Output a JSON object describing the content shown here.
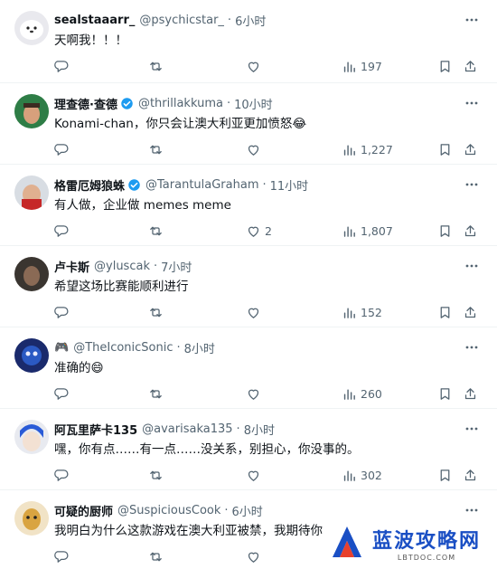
{
  "tweets": [
    {
      "name": "sealstaaarr_",
      "handle": "@psychicstar_",
      "time": "6小时",
      "text": "天啊我！！！",
      "verified": false,
      "likes": "",
      "views": "197"
    },
    {
      "name": "理查德·查德",
      "handle": "@thrillakkuma",
      "time": "10小时",
      "text": "Konami-chan，你只会让澳大利亚更加愤怒😂",
      "verified": true,
      "likes": "",
      "views": "1,227"
    },
    {
      "name": "格雷厄姆狼蛛",
      "handle": "@TarantulaGraham",
      "time": "11小时",
      "text": "有人做，企业做 memes meme",
      "verified": true,
      "likes": "2",
      "views": "1,807"
    },
    {
      "name": "卢卡斯",
      "handle": "@yluscak",
      "time": "7小时",
      "text": "希望这场比赛能顺利进行",
      "verified": false,
      "likes": "",
      "views": "152"
    },
    {
      "name": "🎮",
      "handle": "@TheIconicSonic",
      "time": "8小时",
      "text": "准确的😄",
      "verified": false,
      "likes": "",
      "views": "260"
    },
    {
      "name": "阿瓦里萨卡135",
      "handle": "@avarisaka135",
      "time": "8小时",
      "text": "嘿，你有点……有一点……没关系，别担心，你没事的。",
      "verified": false,
      "likes": "",
      "views": "302"
    },
    {
      "name": "可疑的厨师",
      "handle": "@SuspiciousCook",
      "time": "6小时",
      "text": "我明白为什么这款游戏在澳大利亚被禁，我期待你",
      "verified": false,
      "likes": "",
      "views": ""
    }
  ],
  "watermark": {
    "main": "蓝波攻略网",
    "sub": "LBTDOC.COM"
  },
  "colors": {
    "accent": "#1d9bf0",
    "muted": "#536471",
    "border": "#eff3f4"
  }
}
